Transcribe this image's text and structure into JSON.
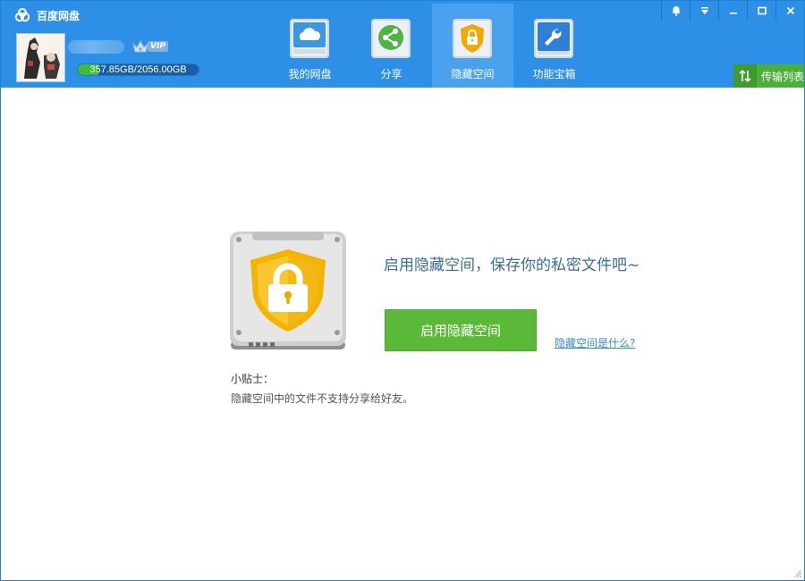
{
  "app": {
    "title": "百度网盘"
  },
  "user": {
    "vip_label": "VIP",
    "quota_text": "357.85GB/2056.00GB",
    "quota_fraction": 0.174
  },
  "nav": {
    "tabs": [
      {
        "label": "我的网盘",
        "icon": "cloud-icon"
      },
      {
        "label": "分享",
        "icon": "share-icon"
      },
      {
        "label": "隐藏空间",
        "icon": "lock-shield-icon",
        "active": true
      },
      {
        "label": "功能宝箱",
        "icon": "wrench-icon"
      }
    ]
  },
  "window_controls": [
    "bell-icon",
    "dropdown-icon",
    "minimize-icon",
    "maximize-icon",
    "close-icon"
  ],
  "transfer": {
    "label": "传输列表"
  },
  "hidden_space": {
    "headline": "启用隐藏空间，保存你的私密文件吧~",
    "enable_button": "启用隐藏空间",
    "help_link": "隐藏空间是什么?",
    "tip_title": "小贴士：",
    "tip_text": "隐藏空间中的文件不支持分享给好友。"
  },
  "colors": {
    "header": "#2d8fe6",
    "active_tab": "#4aa1ec",
    "primary_button": "#5cb839",
    "headline": "#3a6e99",
    "link": "#3b8ad1"
  }
}
